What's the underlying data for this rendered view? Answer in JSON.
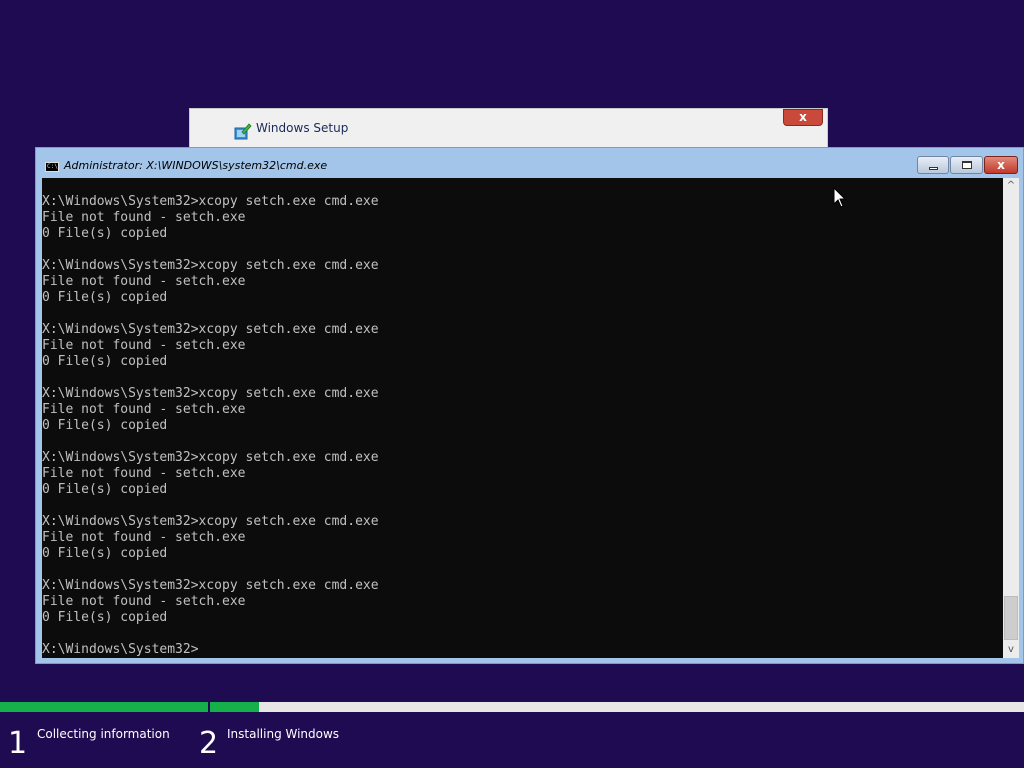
{
  "setup_window": {
    "title": "Windows Setup",
    "close_glyph": "x"
  },
  "cmd_window": {
    "title": "Administrator: X:\\WINDOWS\\system32\\cmd.exe",
    "icon": "cmd-icon",
    "icon_text": "C:\\",
    "buttons": {
      "minimize": "minimize-icon",
      "maximize": "maximize-icon",
      "close_glyph": "x"
    },
    "console_lines": [
      "X:\\Windows\\System32>xcopy setch.exe cmd.exe",
      "File not found - setch.exe",
      "0 File(s) copied",
      "",
      "X:\\Windows\\System32>xcopy setch.exe cmd.exe",
      "File not found - setch.exe",
      "0 File(s) copied",
      "",
      "X:\\Windows\\System32>xcopy setch.exe cmd.exe",
      "File not found - setch.exe",
      "0 File(s) copied",
      "",
      "X:\\Windows\\System32>xcopy setch.exe cmd.exe",
      "File not found - setch.exe",
      "0 File(s) copied",
      "",
      "X:\\Windows\\System32>xcopy setch.exe cmd.exe",
      "File not found - setch.exe",
      "0 File(s) copied",
      "",
      "X:\\Windows\\System32>xcopy setch.exe cmd.exe",
      "File not found - setch.exe",
      "0 File(s) copied",
      "",
      "X:\\Windows\\System32>xcopy setch.exe cmd.exe",
      "File not found - setch.exe",
      "0 File(s) copied",
      "",
      "X:\\Windows\\System32>"
    ],
    "scroll_up_glyph": "^",
    "scroll_down_glyph": "v"
  },
  "progress": {
    "step1_fraction": 1.0,
    "step2_fraction": 0.06,
    "colors": {
      "fill": "#16b04b",
      "track": "#e6e6e6"
    }
  },
  "steps": [
    {
      "number": "1",
      "label": "Collecting information"
    },
    {
      "number": "2",
      "label": "Installing Windows"
    }
  ],
  "colors": {
    "desktop_bg": "#1f0b52",
    "console_bg": "#0c0c0c",
    "console_fg": "#c0c0c0"
  }
}
